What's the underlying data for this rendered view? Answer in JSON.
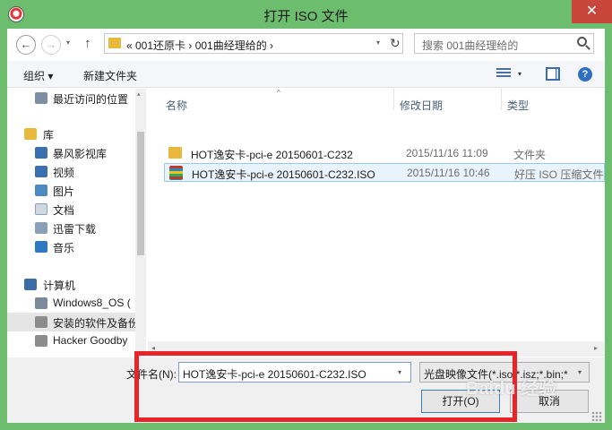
{
  "window": {
    "title": "打开 ISO 文件",
    "close_glyph": "✕"
  },
  "nav": {
    "back_glyph": "←",
    "forward_glyph": "→",
    "dropdown_glyph": "▾",
    "up_glyph": "↑"
  },
  "address": {
    "text": "« 001还原卡 › 001曲经理给的 ›",
    "dropdown_glyph": "▾",
    "refresh_glyph": "↻"
  },
  "search": {
    "placeholder": "搜索 001曲经理给的"
  },
  "toolbar": {
    "organize_label": "组织 ▾",
    "new_folder_label": "新建文件夹",
    "view_dropdown_glyph": "▾",
    "help_glyph": "?"
  },
  "sidebar": {
    "items": [
      {
        "label": "最近访问的位置",
        "icon": "recent-places-icon",
        "color": "#7d8fa3"
      },
      {
        "label": "库",
        "icon": "library-icon",
        "color": "#e8b93c"
      },
      {
        "label": "暴风影视库",
        "icon": "video-library-icon",
        "color": "#3a6fb0"
      },
      {
        "label": "视频",
        "icon": "video-icon",
        "color": "#3a6fb0"
      },
      {
        "label": "图片",
        "icon": "pictures-icon",
        "color": "#4d8ac0"
      },
      {
        "label": "文档",
        "icon": "documents-icon",
        "color": "#cfd8e3"
      },
      {
        "label": "迅雷下载",
        "icon": "download-icon",
        "color": "#8aa0b8"
      },
      {
        "label": "音乐",
        "icon": "music-icon",
        "color": "#2f78c4"
      },
      {
        "label": "计算机",
        "icon": "computer-icon",
        "color": "#3b6ea8"
      },
      {
        "label": "Windows8_OS (",
        "icon": "drive-icon",
        "color": "#7a8a9a"
      },
      {
        "label": "安装的软件及备份",
        "icon": "drive-icon",
        "color": "#8c8c8c"
      },
      {
        "label": "Hacker Goodby",
        "icon": "drive-icon",
        "color": "#8c8c8c"
      }
    ]
  },
  "file_list": {
    "columns": [
      "名称",
      "修改日期",
      "类型"
    ],
    "sort_glyph": "^",
    "rows": [
      {
        "name": "HOT逸安卡-pci-e 20150601-C232",
        "date": "2015/11/16 11:09",
        "type": "文件夹",
        "icon": "folder-icon"
      },
      {
        "name": "HOT逸安卡-pci-e 20150601-C232.ISO",
        "date": "2015/11/16 10:46",
        "type": "好压 ISO 压缩文件",
        "icon": "archive-icon"
      }
    ]
  },
  "scrollbar": {
    "left_glyph": "◂",
    "right_glyph": "▸",
    "up_glyph": "▴"
  },
  "bottom": {
    "filename_label": "文件名(N):",
    "filename_value": "HOT逸安卡-pci-e 20150601-C232.ISO",
    "filetype_value": "光盘映像文件(*.iso;*.isz;*.bin;*",
    "dropdown_glyph": "▾",
    "open_label": "打开(O)",
    "cancel_label": "取消"
  },
  "watermark": {
    "text": "Baidu 经验"
  },
  "colors": {
    "titlebar": "#6cbe6e",
    "close": "#c8453c",
    "highlight": "#e8242b",
    "selection": "#e8f3fc"
  }
}
